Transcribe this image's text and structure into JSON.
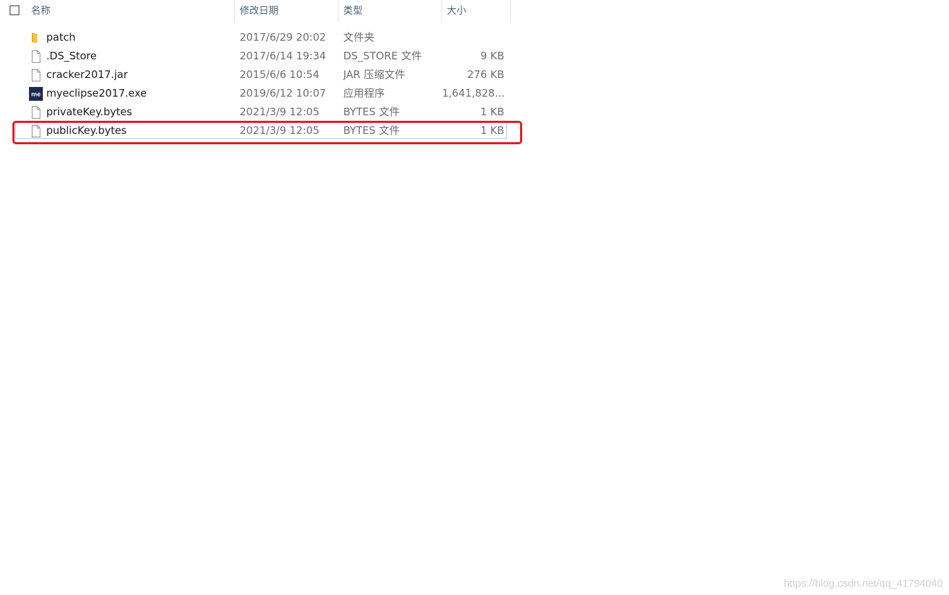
{
  "header": {
    "name": "名称",
    "modified": "修改日期",
    "type": "类型",
    "size": "大小",
    "sort_indicator": "^"
  },
  "files": [
    {
      "name": "patch",
      "modified": "2017/6/29 20:02",
      "type": "文件夹",
      "size": "",
      "icon": "folder-icon"
    },
    {
      "name": ".DS_Store",
      "modified": "2017/6/14 19:34",
      "type": "DS_STORE 文件",
      "size": "9 KB",
      "icon": "file-icon"
    },
    {
      "name": "cracker2017.jar",
      "modified": "2015/6/6 10:54",
      "type": "JAR 压缩文件",
      "size": "276 KB",
      "icon": "file-icon"
    },
    {
      "name": "myeclipse2017.exe",
      "modified": "2019/6/12 10:07",
      "type": "应用程序",
      "size": "1,641,828...",
      "icon": "myeclipse-icon",
      "icon_text": "me"
    },
    {
      "name": "privateKey.bytes",
      "modified": "2021/3/9 12:05",
      "type": "BYTES 文件",
      "size": "1 KB",
      "icon": "file-icon"
    },
    {
      "name": "publicKey.bytes",
      "modified": "2021/3/9 12:05",
      "type": "BYTES 文件",
      "size": "1 KB",
      "icon": "file-icon",
      "selected": true
    }
  ],
  "watermark": "https://blog.csdn.net/qq_41794040",
  "colors": {
    "highlight": "#e8161b",
    "selection_border": "#99d1ff",
    "folder": "#f6c243",
    "myeclipse_bg": "#1b2a4a"
  }
}
